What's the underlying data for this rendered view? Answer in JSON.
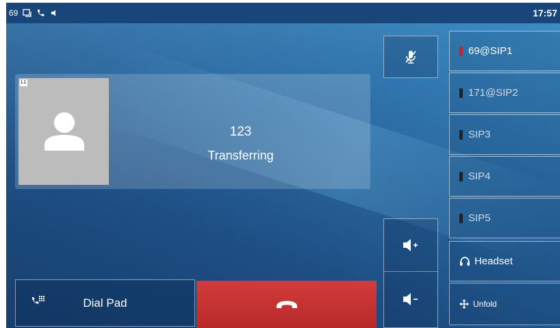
{
  "status_bar": {
    "extension": "69",
    "time": "17:57"
  },
  "call": {
    "avatar_tag": "L1",
    "number": "123",
    "status": "Transferring"
  },
  "line_keys": [
    {
      "label": "69@SIP1",
      "led": "red"
    },
    {
      "label": "171@SIP2",
      "led": "dark"
    },
    {
      "label": "SIP3",
      "led": "dark"
    },
    {
      "label": "SIP4",
      "led": "dark"
    },
    {
      "label": "SIP5",
      "led": "dark"
    },
    {
      "label": "Headset",
      "icon": "headset-icon"
    },
    {
      "label": "Unfold",
      "icon": "unfold-icon"
    }
  ],
  "softkeys": {
    "dial_pad": "Dial Pad"
  },
  "colors": {
    "end_call": "#c43131",
    "led_active": "#d42020",
    "status_bar": "#18467a"
  }
}
